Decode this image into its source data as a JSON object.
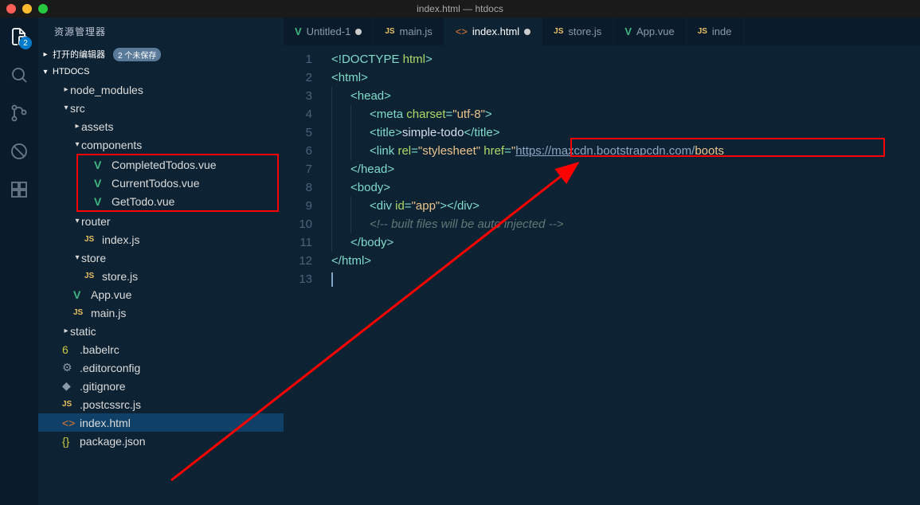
{
  "window": {
    "title": "index.html — htdocs"
  },
  "sidebar": {
    "header": "资源管理器",
    "sections": {
      "open_editors": {
        "label": "打开的编辑器",
        "badge": "2 个未保存"
      },
      "project": {
        "label": "HTDOCS"
      }
    }
  },
  "tree": {
    "node_modules": "node_modules",
    "src": "src",
    "assets": "assets",
    "components": "components",
    "completed_todos": "CompletedTodos.vue",
    "current_todos": "CurrentTodos.vue",
    "get_todo": "GetTodo.vue",
    "router": "router",
    "router_index": "index.js",
    "store": "store",
    "store_js": "store.js",
    "app_vue": "App.vue",
    "main_js": "main.js",
    "static": "static",
    "babelrc": ".babelrc",
    "editorconfig": ".editorconfig",
    "gitignore": ".gitignore",
    "postcssrc": ".postcssrc.js",
    "index_html": "index.html",
    "package_json": "package.json"
  },
  "tabs": {
    "untitled": "Untitled-1",
    "main_js": "main.js",
    "index_html": "index.html",
    "store_js": "store.js",
    "app_vue": "App.vue",
    "inde": "inde"
  },
  "activity": {
    "badge": "2"
  },
  "code": {
    "line1": {
      "a": "<!",
      "b": "DOCTYPE",
      "c": " html",
      "d": ">"
    },
    "line2": {
      "a": "<",
      "b": "html",
      "c": ">"
    },
    "line3": {
      "a": "<",
      "b": "head",
      "c": ">"
    },
    "line4": {
      "a": "<",
      "b": "meta",
      "c": " charset",
      "d": "=",
      "e": "\"utf-8\"",
      "f": ">"
    },
    "line5": {
      "a": "<",
      "b": "title",
      "c": ">",
      "d": "simple-todo",
      "e": "</",
      "f": "title",
      "g": ">"
    },
    "line6": {
      "a": "<",
      "b": "link",
      "c": " rel",
      "d": "=",
      "e": "\"stylesheet\"",
      "f": " href",
      "g": "=",
      "h": "\"",
      "i": "https://maxcdn.bootstrapcdn.com/",
      "j": "boots"
    },
    "line7": {
      "a": "</",
      "b": "head",
      "c": ">"
    },
    "line8": {
      "a": "<",
      "b": "body",
      "c": ">"
    },
    "line9": {
      "a": "<",
      "b": "div",
      "c": " id",
      "d": "=",
      "e": "\"app\"",
      "f": "></",
      "g": "div",
      "h": ">"
    },
    "line10": {
      "a": "<!-- built files will be auto injected -->"
    },
    "line11": {
      "a": "</",
      "b": "body",
      "c": ">"
    },
    "line12": {
      "a": "</",
      "b": "html",
      "c": ">"
    }
  },
  "line_numbers": {
    "l1": "1",
    "l2": "2",
    "l3": "3",
    "l4": "4",
    "l5": "5",
    "l6": "6",
    "l7": "7",
    "l8": "8",
    "l9": "9",
    "l10": "10",
    "l11": "11",
    "l12": "12",
    "l13": "13"
  }
}
